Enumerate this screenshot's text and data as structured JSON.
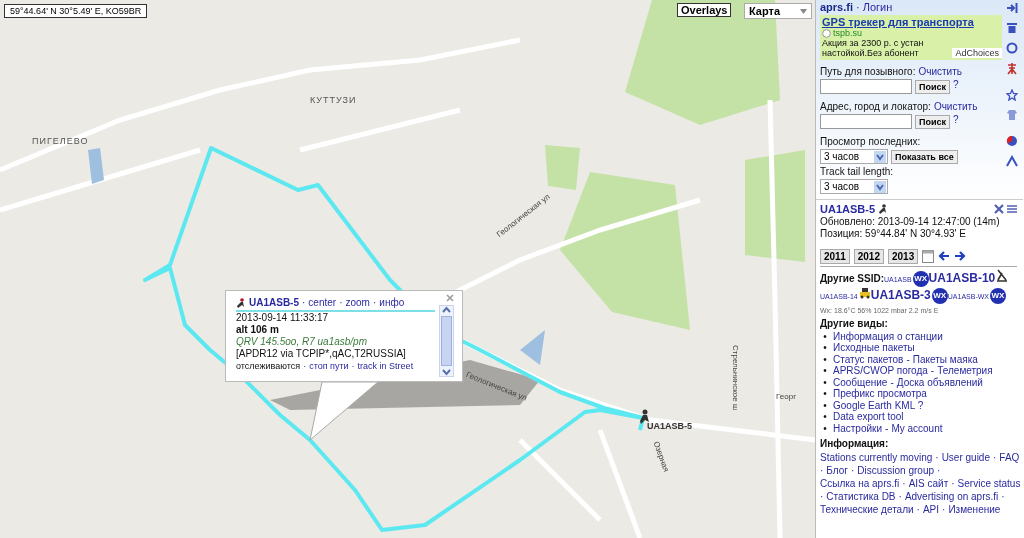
{
  "coordinates": "59°44.64' N 30°5.49' E, KO59BR",
  "map_controls": {
    "overlays": "Overlays",
    "map_type": "Карта"
  },
  "map": {
    "labels": [
      {
        "text": "КУТТУЗИ",
        "kind": "place"
      },
      {
        "text": "ПИГЕЛЕВО",
        "kind": "place"
      },
      {
        "text": "Геологическая ул",
        "kind": "street"
      },
      {
        "text": "Геологическая ул",
        "kind": "street"
      },
      {
        "text": "Стрельнинское ш",
        "kind": "street"
      },
      {
        "text": "Георг",
        "kind": "street"
      },
      {
        "text": "Озерная",
        "kind": "street"
      }
    ],
    "station_label": "UA1ASB-5"
  },
  "popup": {
    "callsign": "UA1ASB-5",
    "separator": "·",
    "links": [
      "center",
      "zoom",
      "инфо"
    ],
    "time": "2013-09-14 11:33:17",
    "altitude": "alt 106 m",
    "comment": "QRV 145.5oo, R7 ua1asb/pm",
    "path": "[APDR12 via TCPIP*,qAC,T2RUSSIA]",
    "footer_label": "отслеживаются",
    "footer_links": [
      "стоп пути",
      "track in Street"
    ]
  },
  "sidebar": {
    "header": {
      "site": "aprs.fi",
      "separator": "·",
      "login": "Логин"
    },
    "ad": {
      "title": "GPS трекер для транспорта",
      "domain": "tspb.su",
      "lines": [
        "Акция за 2300 р. с устан",
        "настойкой.Без абонент"
      ],
      "adchoices": "AdChoices"
    },
    "searches": [
      {
        "label": "Путь для позывного:",
        "clear": "Очистить",
        "button": "Поиск",
        "help": "?"
      },
      {
        "label": "Адрес, город и локатор:",
        "clear": "Очистить",
        "button": "Поиск",
        "help": "?"
      }
    ],
    "view_last": {
      "label": "Просмотр последних:",
      "value": "3 часов",
      "button": "Показать все"
    },
    "tail": {
      "label": "Track tail length:",
      "value": "3 часов"
    },
    "station": {
      "callsign": "UA1ASB-5",
      "updated": "Обновлено: 2013-09-14 12:47:00 (14m)",
      "position": "Позиция: 59°44.84' N 30°4.93' E",
      "years": [
        "2011",
        "2012",
        "2013"
      ]
    },
    "ssid": {
      "title": "Другие SSID:",
      "items": [
        {
          "label": "UA1ASB",
          "emphasis": false,
          "kind": "wx",
          "icon_text": "WX"
        },
        {
          "label": "UA1ASB-10",
          "emphasis": true,
          "kind": "antenna"
        },
        {
          "label": "UA1ASB-14",
          "emphasis": false,
          "kind": "car"
        },
        {
          "label": "UA1ASB-3",
          "emphasis": true,
          "kind": "wx",
          "icon_text": "WX"
        },
        {
          "label": "UA1ASB-WX",
          "emphasis": false,
          "kind": "wx",
          "icon_text": "WX"
        }
      ],
      "weather": "Wx: 18.6°C 56% 1022 mbar 2.2 m/s E"
    },
    "views": {
      "title": "Другие виды:",
      "bullet": "•",
      "separator": "-",
      "items": [
        [
          "Информация о станции"
        ],
        [
          "Исходные пакеты"
        ],
        [
          "Статус пакетов",
          "Пакеты маяка"
        ],
        [
          "APRS/CWOP погода",
          "Телеметрия"
        ],
        [
          "Сообщение",
          "Доска объявлений"
        ],
        [
          "Префикс просмотра"
        ],
        [
          "Google Earth KML ?"
        ],
        [
          "Data export tool"
        ],
        [
          "Настройки",
          "My account"
        ]
      ]
    },
    "info": {
      "title": "Информация:",
      "separator": "·",
      "links": [
        "Stations currently moving",
        "User guide",
        "FAQ",
        "Блог",
        "Discussion group",
        "Ссылка на aprs.fi",
        "AIS сайт",
        "Service status",
        "Статистика DB",
        "Advertising on aprs.fi",
        "Технические детали",
        "API",
        "Изменение"
      ]
    }
  }
}
